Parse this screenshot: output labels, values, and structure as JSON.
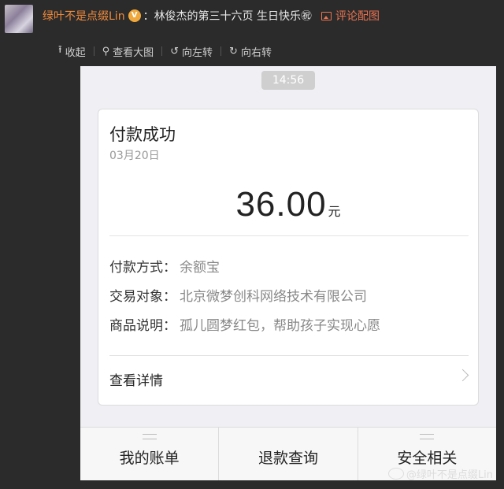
{
  "post": {
    "username": "绿叶不是点缀Lin",
    "badge": "V",
    "colon": "：",
    "text": "林俊杰的第三十六页 生日快乐",
    "emoji": "㊗",
    "comment_pic": "评论配图"
  },
  "toolbar": {
    "collapse": "收起",
    "view_large": "查看大图",
    "rotate_left": "向左转",
    "rotate_right": "向右转",
    "collapse_icon": "⭱",
    "view_icon": "⚲",
    "left_icon": "↺",
    "right_icon": "↻"
  },
  "phone": {
    "time": "14:56",
    "card": {
      "title": "付款成功",
      "date": "03月20日",
      "amount": "36.00",
      "unit": "元",
      "rows": [
        {
          "label": "付款方式：",
          "value": "余额宝"
        },
        {
          "label": "交易对象：",
          "value": "北京微梦创科网络技术有限公司"
        },
        {
          "label": "商品说明：",
          "value": "孤儿圆梦红包，帮助孩子实现心愿"
        }
      ],
      "detail": "查看详情"
    },
    "tabs": [
      "我的账单",
      "退款查询",
      "安全相关"
    ]
  },
  "watermark": "@绿叶不是点缀Lin"
}
